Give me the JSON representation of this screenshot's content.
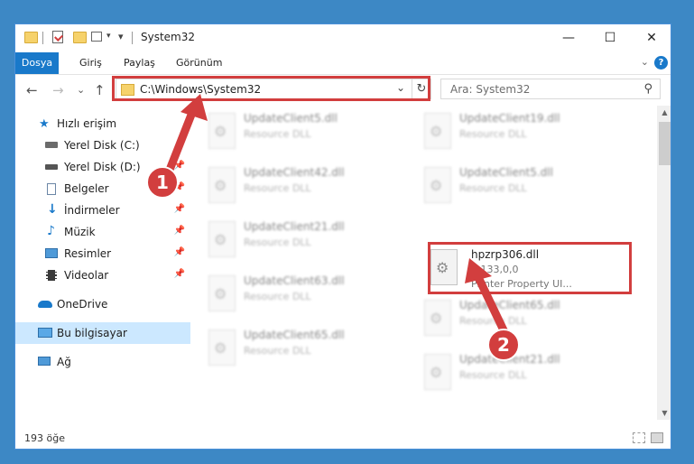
{
  "window": {
    "title": "System32",
    "controls": {
      "minimize": "—",
      "maximize": "☐",
      "close": "✕"
    }
  },
  "ribbon": {
    "tabs": [
      "Dosya",
      "Giriş",
      "Paylaş",
      "Görünüm"
    ],
    "expand_glyph": "⌄",
    "help_glyph": "?"
  },
  "address": {
    "path": "C:\\Windows\\System32",
    "dropdown_glyph": "⌄",
    "refresh_glyph": "↻"
  },
  "nav_buttons": {
    "back": "←",
    "forward": "→",
    "recent": "⌄",
    "up": "↑"
  },
  "search": {
    "placeholder": "Ara: System32",
    "icon_glyph": "⚲"
  },
  "navigation": {
    "quick_access": "Hızlı erişim",
    "items": [
      {
        "label": "Yerel Disk (C:)",
        "icon": "drive-icon",
        "pinned": false
      },
      {
        "label": "Yerel Disk (D:)",
        "icon": "drive-icon",
        "pinned": true
      },
      {
        "label": "Belgeler",
        "icon": "documents-icon",
        "pinned": true
      },
      {
        "label": "İndirmeler",
        "icon": "download-icon",
        "pinned": true
      },
      {
        "label": "Müzik",
        "icon": "music-icon",
        "pinned": true
      },
      {
        "label": "Resimler",
        "icon": "pictures-icon",
        "pinned": true
      },
      {
        "label": "Videolar",
        "icon": "videos-icon",
        "pinned": true
      }
    ],
    "onedrive": "OneDrive",
    "this_pc": "Bu bilgisayar",
    "network": "Ağ",
    "pin_glyph": "📌"
  },
  "files": {
    "left": [
      {
        "name": "UpdateClient5.dll",
        "type": "Resource DLL"
      },
      {
        "name": "UpdateClient42.dll",
        "type": "Resource DLL"
      },
      {
        "name": "UpdateClient21.dll",
        "type": "Resource DLL"
      },
      {
        "name": "UpdateClient63.dll",
        "type": "Resource DLL"
      },
      {
        "name": "UpdateClient65.dll",
        "type": "Resource DLL"
      }
    ],
    "right": [
      {
        "name": "UpdateClient19.dll",
        "type": "Resource DLL"
      },
      {
        "name": "UpdateClient5.dll",
        "type": "Resource DLL"
      },
      {
        "name": "UpdateClient65.dll",
        "type": "Resource DLL"
      },
      {
        "name": "UpdateClient21.dll",
        "type": "Resource DLL"
      }
    ],
    "highlighted": {
      "name": "hpzrp306.dll",
      "version": "2,133,0,0",
      "description": "Printer Property UI..."
    }
  },
  "status": {
    "count": "193 öğe"
  },
  "callouts": {
    "first": "1",
    "second": "2"
  },
  "colors": {
    "accent": "#1979ca",
    "highlight": "#d23e3e",
    "selection": "#cce8ff"
  }
}
